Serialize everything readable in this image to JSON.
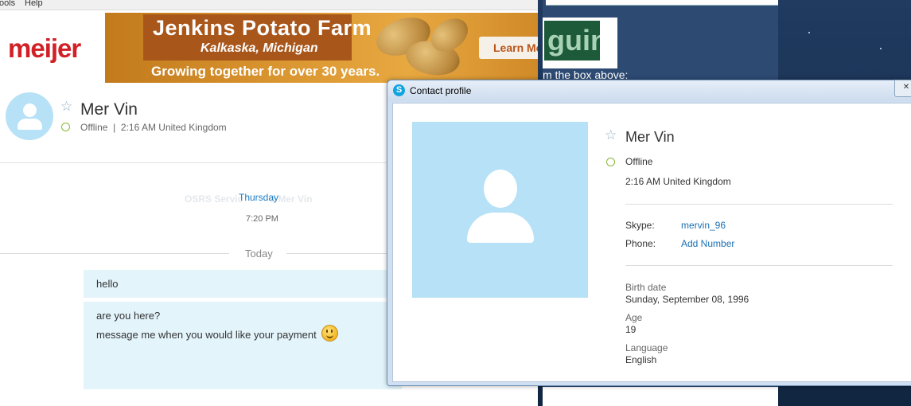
{
  "menu": {
    "tools": "ools",
    "help": "Help"
  },
  "ad": {
    "brand": "meijer",
    "title": "Jenkins Potato Farm",
    "location": "Kalkaska, Michigan",
    "tagline": "Growing together for over 30 years.",
    "cta": "Learn Mo"
  },
  "contact": {
    "name": "Mer Vin",
    "status": "Offline",
    "local_time": "2:16 AM United Kingdom",
    "status_line": "Offline  |  2:16 AM United Kingdom"
  },
  "chat": {
    "faded_header": "OSRS Servic          d Mer Vin",
    "thursday": "Thursday",
    "thursday_time": "7:20 PM",
    "today": "Today",
    "messages": [
      {
        "text": "hello"
      },
      {
        "line1": "are you here?",
        "line2": "message me when you would like your payment"
      }
    ]
  },
  "background_window": {
    "captcha_text": "guin",
    "instructions": "m the box above:"
  },
  "profile_dialog": {
    "title": "Contact profile",
    "close": "✕",
    "name": "Mer Vin",
    "status": "Offline",
    "local_time": "2:16 AM United Kingdom",
    "skype_label": "Skype:",
    "skype_value": "mervin_96",
    "phone_label": "Phone:",
    "phone_value": "Add Number",
    "birth_label": "Birth date",
    "birth_value": "Sunday, September 08, 1996",
    "age_label": "Age",
    "age_value": "19",
    "language_label": "Language",
    "language_value": "English"
  },
  "colors": {
    "skype_blue": "#1a7bc4",
    "bubble": "#e3f4fb",
    "avatar": "#b6e1f6",
    "status_offline": "#8ab638",
    "meijer_red": "#d22027"
  }
}
